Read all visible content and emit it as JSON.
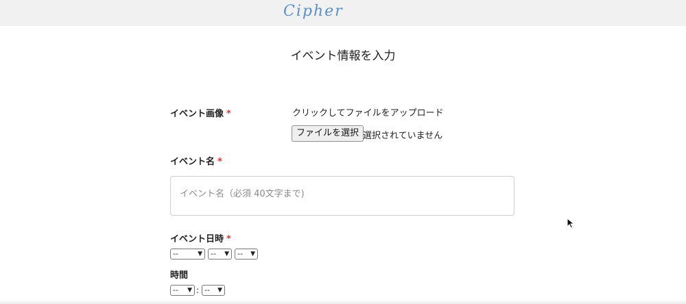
{
  "header": {
    "logo": "Cipher"
  },
  "page": {
    "title": "イベント情報を入力"
  },
  "form": {
    "required_mark": "*",
    "image": {
      "label": "イベント画像",
      "upload_hint": "クリックしてファイルをアップロード",
      "choose_button": "ファイルを選択",
      "no_file": "選択されていません"
    },
    "name": {
      "label": "イベント名",
      "placeholder": "イベント名（必須 40文字まで)"
    },
    "date": {
      "label": "イベント日時",
      "year": "--",
      "month": "--",
      "day": "--"
    },
    "time": {
      "label": "時間",
      "hour": "--",
      "minute": "--",
      "separator": ":"
    }
  },
  "colors": {
    "logo": "#5b8fc9",
    "required": "#e0342c",
    "header_bg": "#f1f1f1"
  }
}
